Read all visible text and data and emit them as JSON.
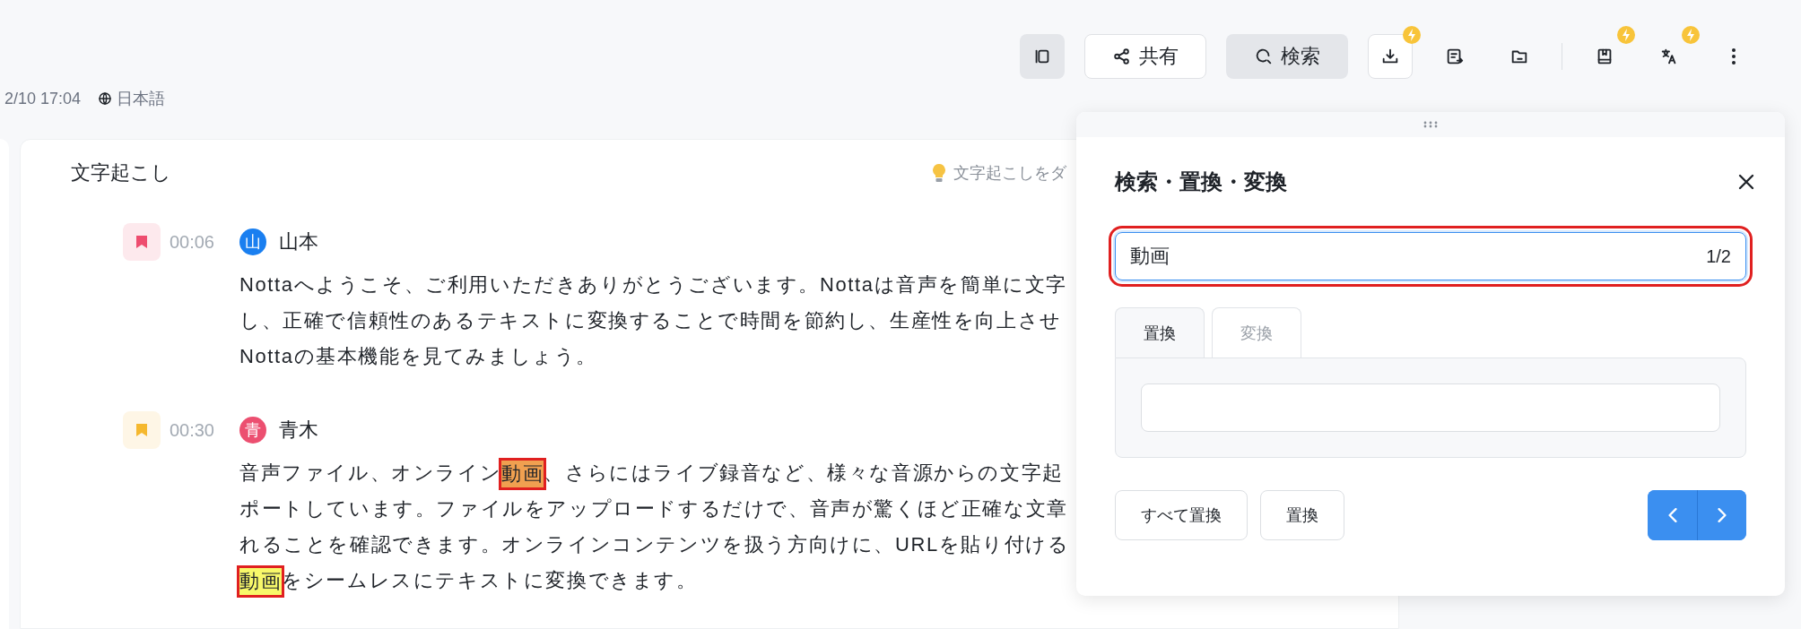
{
  "toolbar": [
    {
      "kind": "filled"
    },
    {
      "kind": "outlined",
      "label": "共有"
    },
    {
      "kind": "filled",
      "label": "検索"
    },
    {
      "kind": "outlined",
      "badge": true
    },
    {
      "kind": "plain"
    },
    {
      "kind": "plain"
    },
    {
      "kind": "plain",
      "badge": true
    },
    {
      "kind": "plain",
      "badge": true
    },
    {
      "kind": "plain"
    }
  ],
  "meta": {
    "datetime": "2/10 17:04",
    "language": "日本語"
  },
  "transcript": {
    "title": "文字起こし",
    "hint": "文字起こしをダ",
    "entries": [
      {
        "marker": {
          "color": "#ee4d6f"
        },
        "time": "00:06",
        "speaker": {
          "initial": "山",
          "name": "山本",
          "color": "#1a7ff0"
        },
        "lines": [
          [
            {
              "text": "Nottaへようこそ、ご利用いただきありがとうございます。Nottaは音声を簡単に文字"
            }
          ],
          [
            {
              "text": "し、正確で信頼性のあるテキストに変換することで時間を節約し、生産性を向上させ"
            }
          ],
          [
            {
              "text": "Nottaの基本機能を見てみましょう。"
            }
          ]
        ]
      },
      {
        "marker": {
          "color": "#f5b82e"
        },
        "time": "00:30",
        "speaker": {
          "initial": "青",
          "name": "青木",
          "color": "#ec4f70"
        },
        "lines": [
          [
            {
              "text": "音声ファイル、オンライン"
            },
            {
              "text": "動画",
              "highlighted": true,
              "current": true,
              "boxed": true
            },
            {
              "text": "、さらにはライブ録音など、様々な音源からの文字起"
            }
          ],
          [
            {
              "text": "ポートしています。ファイルをアップロードするだけで、音声が驚くほど正確な文章"
            }
          ],
          [
            {
              "text": "れることを確認できます。オンラインコンテンツを扱う方向けに、URLを貼り付ける"
            }
          ],
          [
            {
              "text": "動画",
              "highlighted": true,
              "current": false,
              "boxed": true
            },
            {
              "text": "をシームレスにテキストに変換できます。"
            }
          ]
        ]
      }
    ]
  },
  "panel": {
    "title": "検索・置換・変換",
    "search": {
      "value": "動画",
      "count": "1/2",
      "boxed": true
    },
    "tabs": [
      {
        "label": "置換",
        "selected": true
      },
      {
        "label": "変換",
        "selected": false
      }
    ],
    "buttons": [
      "すべて置換",
      "置換"
    ]
  }
}
